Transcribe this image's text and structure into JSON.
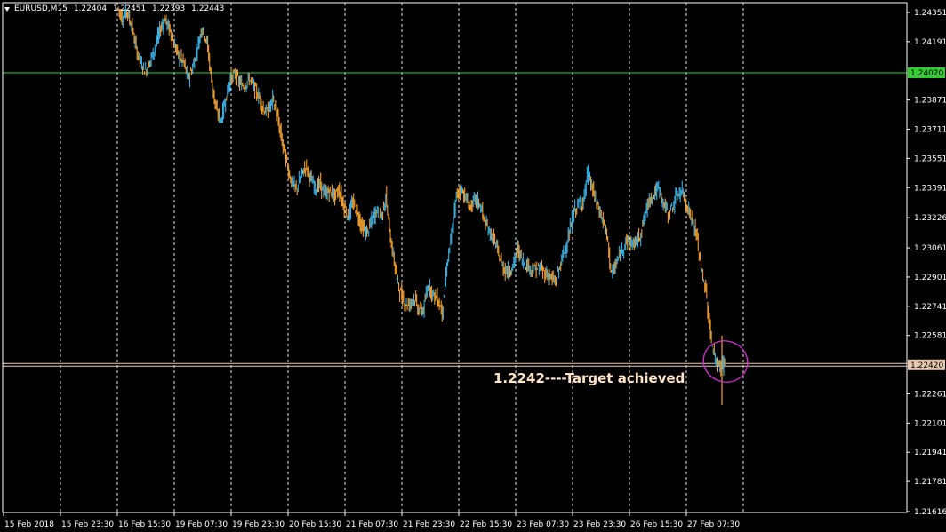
{
  "header": {
    "symbol": "EURUSD,M15",
    "open": "1.22404",
    "high": "1.22451",
    "low": "1.22393",
    "close": "1.22443"
  },
  "colors": {
    "background": "#000000",
    "axis": "#ffffff",
    "grid": "#ffffff",
    "candle_up": "#3aaee0",
    "candle_down": "#f0a030",
    "level_line": "#33cc33",
    "target_line": "#e8c8b0",
    "circle": "#cc33cc",
    "annotation_text": "#ffe4c8"
  },
  "chart_data": {
    "type": "line",
    "title": "EURUSD,M15",
    "y_ticks": [
      "1.24351",
      "1.24191",
      "1.23871",
      "1.23711",
      "1.23551",
      "1.23391",
      "1.23226",
      "1.23061",
      "1.22901",
      "1.22741",
      "1.22581",
      "1.22261",
      "1.22101",
      "1.21941",
      "1.21781",
      "1.21616"
    ],
    "x_ticks": [
      "15 Feb 2018",
      "15 Feb 23:30",
      "16 Feb 15:30",
      "19 Feb 07:30",
      "19 Feb 23:30",
      "20 Feb 15:30",
      "21 Feb 07:30",
      "21 Feb 23:30",
      "22 Feb 15:30",
      "23 Feb 07:30",
      "23 Feb 23:30",
      "26 Feb 15:30",
      "27 Feb 07:30"
    ],
    "ylim": [
      1.21616,
      1.24351
    ],
    "grid": true,
    "levels": [
      {
        "price": 1.2402,
        "label": "1.24020",
        "kind": "resistance"
      },
      {
        "price": 1.2242,
        "label": "1.22420",
        "kind": "target"
      }
    ],
    "annotation": "1.2242----Target achieved",
    "series": [
      {
        "values": [
          1.2438,
          1.2432,
          1.2436,
          1.2428,
          1.2415,
          1.2407,
          1.2403,
          1.2409,
          1.2416,
          1.2425,
          1.2432,
          1.2426,
          1.2418,
          1.2411,
          1.2408,
          1.2399,
          1.2405,
          1.2416,
          1.2428,
          1.2419,
          1.2398,
          1.2381,
          1.2376,
          1.2388,
          1.2399,
          1.2401,
          1.2396,
          1.2395,
          1.2399,
          1.2394,
          1.2389,
          1.2382,
          1.238,
          1.2388,
          1.2377,
          1.2364,
          1.2352,
          1.2342,
          1.2338,
          1.2346,
          1.2351,
          1.2344,
          1.2339,
          1.2341,
          1.2336,
          1.2337,
          1.2334,
          1.2338,
          1.233,
          1.2323,
          1.2331,
          1.2325,
          1.2317,
          1.2314,
          1.2321,
          1.2327,
          1.2322,
          1.2334,
          1.2311,
          1.2295,
          1.2282,
          1.2276,
          1.2275,
          1.2279,
          1.2272,
          1.2272,
          1.2286,
          1.2281,
          1.2278,
          1.2271,
          1.2297,
          1.2313,
          1.2335,
          1.2339,
          1.2333,
          1.2328,
          1.2333,
          1.233,
          1.232,
          1.2315,
          1.2311,
          1.2302,
          1.2295,
          1.2293,
          1.2296,
          1.2306,
          1.2299,
          1.2297,
          1.2294,
          1.2295,
          1.2294,
          1.2292,
          1.229,
          1.2287,
          1.2296,
          1.2305,
          1.2314,
          1.2326,
          1.233,
          1.2332,
          1.2348,
          1.2337,
          1.2329,
          1.2322,
          1.2312,
          1.2291,
          1.2298,
          1.2304,
          1.231,
          1.2309,
          1.2308,
          1.2313,
          1.2323,
          1.2333,
          1.2336,
          1.2339,
          1.233,
          1.2325,
          1.2329,
          1.2336,
          1.2337,
          1.2329,
          1.2322,
          1.2313,
          1.2295,
          1.2282,
          1.2258,
          1.2244,
          1.2241,
          1.2244
        ]
      }
    ]
  }
}
